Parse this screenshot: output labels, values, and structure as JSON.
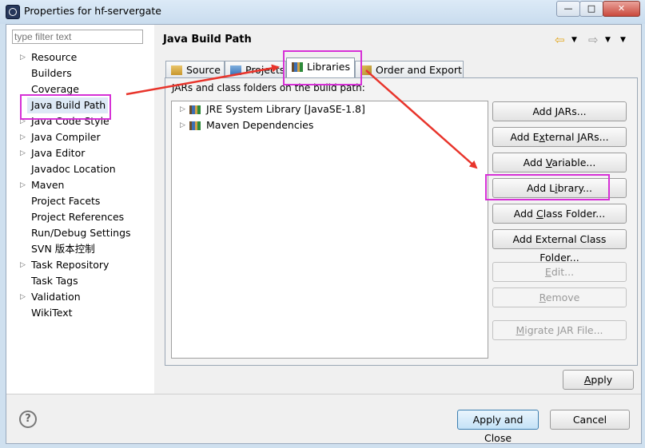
{
  "window": {
    "title": "Properties for hf-servergate",
    "min_glyph": "—",
    "max_glyph": "□",
    "close_glyph": "✕"
  },
  "sidebar": {
    "filter_placeholder": "type filter text",
    "items": [
      {
        "label": "Resource",
        "expandable": true
      },
      {
        "label": "Builders",
        "expandable": false
      },
      {
        "label": "Coverage",
        "expandable": false
      },
      {
        "label": "Java Build Path",
        "expandable": false,
        "selected": true
      },
      {
        "label": "Java Code Style",
        "expandable": true
      },
      {
        "label": "Java Compiler",
        "expandable": true
      },
      {
        "label": "Java Editor",
        "expandable": true
      },
      {
        "label": "Javadoc Location",
        "expandable": false
      },
      {
        "label": "Maven",
        "expandable": true
      },
      {
        "label": "Project Facets",
        "expandable": false
      },
      {
        "label": "Project References",
        "expandable": false
      },
      {
        "label": "Run/Debug Settings",
        "expandable": false
      },
      {
        "label": "SVN 版本控制",
        "expandable": false
      },
      {
        "label": "Task Repository",
        "expandable": true
      },
      {
        "label": "Task Tags",
        "expandable": false
      },
      {
        "label": "Validation",
        "expandable": true
      },
      {
        "label": "WikiText",
        "expandable": false
      }
    ]
  },
  "header": {
    "page_title": "Java Build Path",
    "back_icon": "back-arrow-icon",
    "forward_icon": "forward-arrow-icon"
  },
  "tabs": [
    {
      "label": "Source",
      "icon": "source-folder-icon"
    },
    {
      "label": "Projects",
      "icon": "projects-icon"
    },
    {
      "label": "Libraries",
      "icon": "libraries-icon",
      "active": true
    },
    {
      "label": "Order and Export",
      "icon": "order-export-icon"
    }
  ],
  "libraries": {
    "description": "JARs and class folders on the build path:",
    "entries": [
      {
        "label": "JRE System Library [JavaSE-1.8]"
      },
      {
        "label": "Maven Dependencies"
      }
    ]
  },
  "buttons": {
    "add_jars": [
      "Add ",
      "J",
      "ARs..."
    ],
    "add_external_jars": [
      "Add E",
      "x",
      "ternal JARs..."
    ],
    "add_variable": [
      "Add ",
      "V",
      "ariable..."
    ],
    "add_library": [
      "Add L",
      "i",
      "brary..."
    ],
    "add_class_folder": [
      "Add ",
      "C",
      "lass Folder..."
    ],
    "add_external_class_folder": [
      "Add External Class Fol",
      "d",
      "er..."
    ],
    "edit": [
      "",
      "E",
      "dit..."
    ],
    "remove": [
      "",
      "R",
      "emove"
    ],
    "migrate": [
      "",
      "M",
      "igrate JAR File..."
    ],
    "apply": [
      "",
      "A",
      "pply"
    ],
    "apply_and_close": "Apply and Close",
    "cancel": "Cancel"
  },
  "help_icon": "?",
  "annotation_color": "#d631d6",
  "arrow_color": "#e8342b"
}
